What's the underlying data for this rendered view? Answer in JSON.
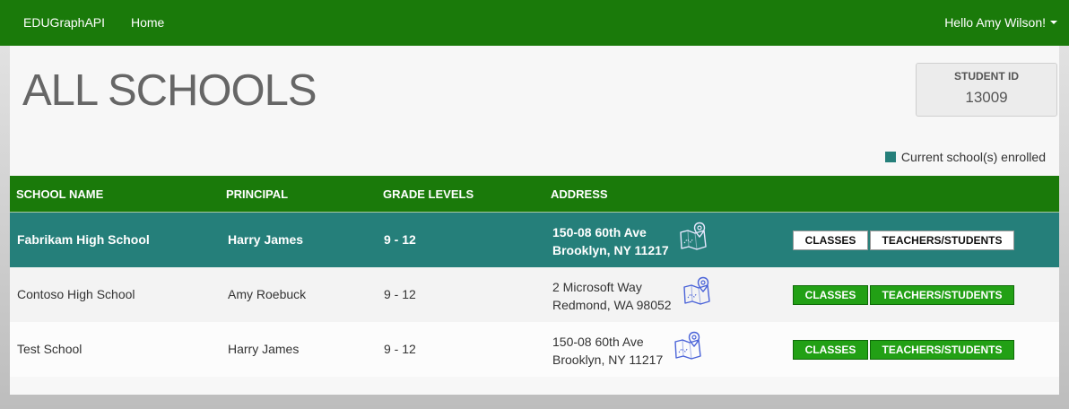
{
  "nav": {
    "brand": "EDUGraphAPI",
    "home": "Home",
    "user_greeting": "Hello Amy Wilson!"
  },
  "page": {
    "title": "ALL SCHOOLS",
    "student_id_label": "STUDENT ID",
    "student_id_value": "13009",
    "legend_text": "Current school(s) enrolled",
    "legend_color": "#257f7a"
  },
  "colors": {
    "nav_green": "#1a7a0a",
    "button_green": "#22a015"
  },
  "table": {
    "headers": {
      "name": "SCHOOL NAME",
      "principal": "PRINCIPAL",
      "grades": "GRADE LEVELS",
      "address": "ADDRESS"
    },
    "rows": [
      {
        "name": "Fabrikam High School",
        "principal": "Harry James",
        "grades": "9 - 12",
        "address_line1": "150-08 60th Ave",
        "address_line2": "Brooklyn, NY 11217",
        "map_icon": "map-pin-icon",
        "classes_label": "CLASSES",
        "teachers_label": "TEACHERS/STUDENTS",
        "current": true
      },
      {
        "name": "Contoso High School",
        "principal": "Amy Roebuck",
        "grades": "9 - 12",
        "address_line1": "2 Microsoft Way",
        "address_line2": "Redmond, WA 98052",
        "map_icon": "map-pin-icon",
        "classes_label": "CLASSES",
        "teachers_label": "TEACHERS/STUDENTS",
        "current": false
      },
      {
        "name": "Test School",
        "principal": "Harry James",
        "grades": "9 - 12",
        "address_line1": "150-08 60th Ave",
        "address_line2": "Brooklyn, NY 11217",
        "map_icon": "map-pin-icon",
        "classes_label": "CLASSES",
        "teachers_label": "TEACHERS/STUDENTS",
        "current": false
      }
    ]
  }
}
